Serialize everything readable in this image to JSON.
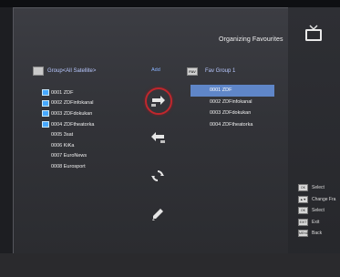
{
  "header": {
    "title": "Organizing Favourites"
  },
  "source": {
    "header": "Group<All Satellite>",
    "channels": [
      {
        "label": "0001 ZDF",
        "icon": "tv-channel-icon"
      },
      {
        "label": "0002 ZDFinfokanal",
        "icon": "tv-channel-icon"
      },
      {
        "label": "0003 ZDFdokukan",
        "icon": "tv-channel-icon"
      },
      {
        "label": "0004 ZDFtheatorka",
        "icon": "tv-channel-icon"
      },
      {
        "label": "0005 3sat",
        "icon": ""
      },
      {
        "label": "0006 KiKa",
        "icon": ""
      },
      {
        "label": "0007 EuroNews",
        "icon": ""
      },
      {
        "label": "0008 Eurosport",
        "icon": ""
      }
    ]
  },
  "actions": {
    "add_label": "Add",
    "buttons": [
      {
        "name": "add-arrow-icon",
        "selected": true
      },
      {
        "name": "remove-arrow-icon",
        "selected": false
      },
      {
        "name": "move-icon",
        "selected": false
      },
      {
        "name": "rename-pencil-icon",
        "selected": false
      }
    ]
  },
  "favourites": {
    "header": "Fav Group 1",
    "badge": "FAV",
    "channels": [
      "0001 ZDF",
      "0002 ZDFinfokanal",
      "0003 ZDFdokukan",
      "0004 ZDFtheatorka"
    ],
    "selected_index": 0
  },
  "legend": [
    {
      "key": "OK",
      "label": "Select"
    },
    {
      "key": "▲▼",
      "label": "Change Fra"
    },
    {
      "key": "OK",
      "label": "Select"
    },
    {
      "key": "EXIT",
      "label": "Exit"
    },
    {
      "key": "MENU",
      "label": "Back"
    }
  ],
  "colors": {
    "highlight": "#5f86c8",
    "selection_ring": "#c0272d",
    "header_text": "#b8c8ff"
  }
}
